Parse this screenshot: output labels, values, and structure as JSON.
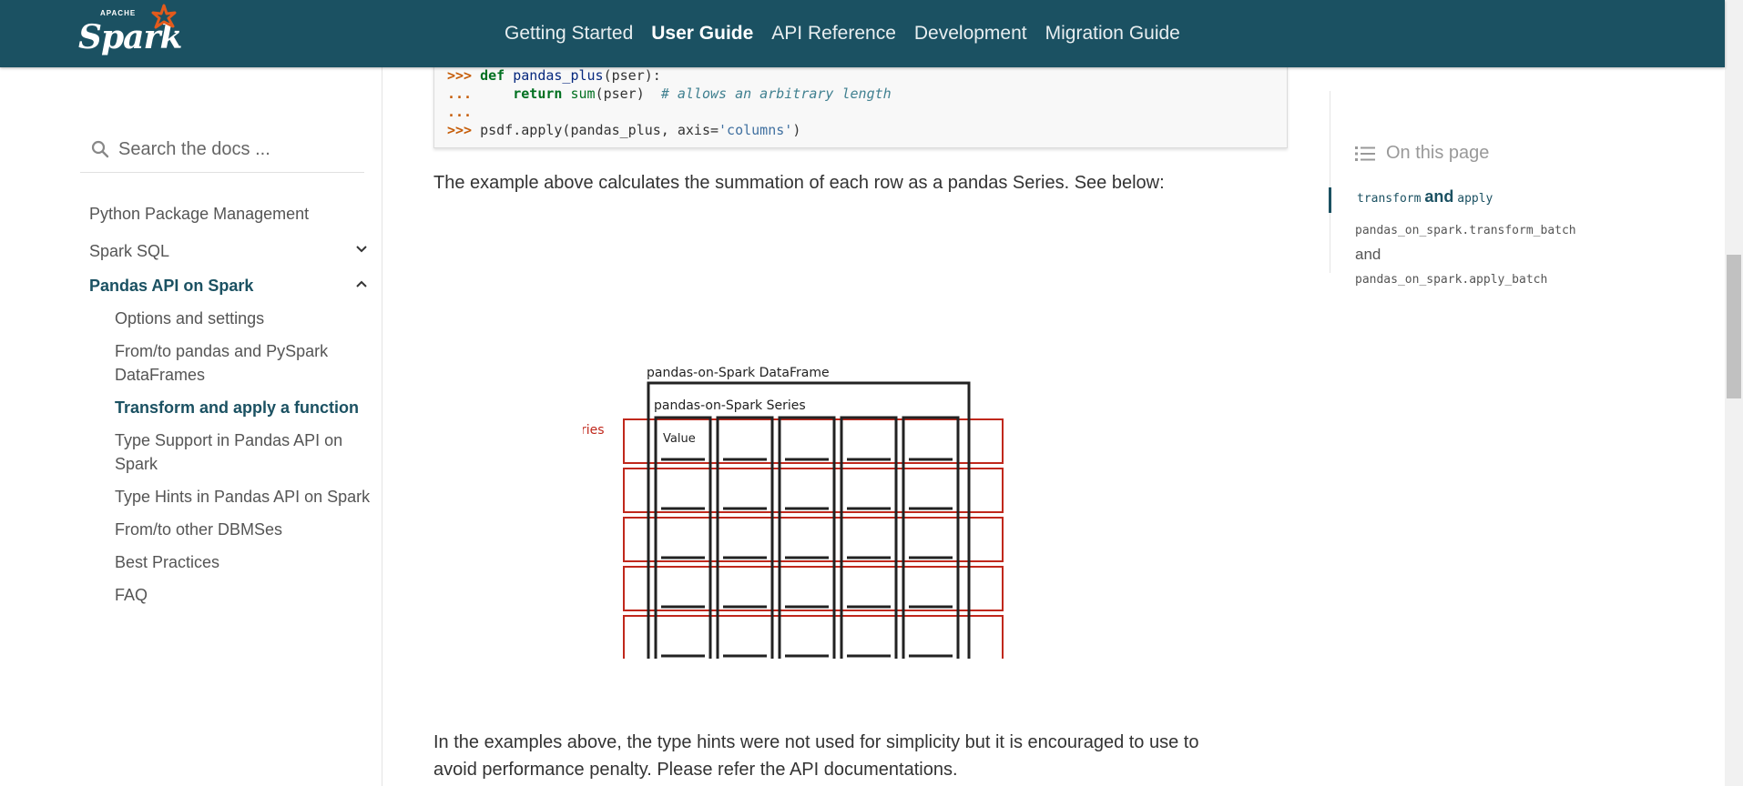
{
  "brand": {
    "apache": "APACHE",
    "spark": "Spark"
  },
  "nav": {
    "items": [
      "Getting Started",
      "User Guide",
      "API Reference",
      "Development",
      "Migration Guide"
    ],
    "active": "User Guide"
  },
  "sidebar": {
    "search_placeholder": "Search the docs ...",
    "items": [
      {
        "label": "Python Package Management"
      },
      {
        "label": "Spark SQL"
      },
      {
        "label": "Pandas API on Spark"
      },
      {
        "label": "Options and settings"
      },
      {
        "label": "From/to pandas and PySpark DataFrames"
      },
      {
        "label": "Transform and apply a function"
      },
      {
        "label": "Type Support in Pandas API on Spark"
      },
      {
        "label": "Type Hints in Pandas API on Spark"
      },
      {
        "label": "From/to other DBMSes"
      },
      {
        "label": "Best Practices"
      },
      {
        "label": "FAQ"
      }
    ]
  },
  "code": {
    "prompt1": ">>>",
    "kw_def": "def",
    "fn_name": "pandas_plus",
    "args": "(pser):",
    "prompt2": "...",
    "kw_return": "return",
    "bi_sum": "sum",
    "sum_args": "(pser)",
    "comment": "# allows an arbitrary length",
    "prompt3": "...",
    "prompt4": ">>>",
    "apply_call": "psdf.apply(pandas_plus, axis=",
    "apply_str": "'columns'",
    "apply_end": ")"
  },
  "main": {
    "para1": "The example above calculates the summation of each row as a pandas Series. See below:",
    "para2_line1": "In the examples above, the type hints were not used for simplicity but it is encouraged to use to",
    "para2_line2": "avoid performance penalty. Please refer the API documentations."
  },
  "figure": {
    "df_label": "pandas-on-Spark DataFrame",
    "series_label": "pandas-on-Spark Series",
    "pandas_series_label": "Pandas Series",
    "value_label": "Value",
    "rows": 6,
    "cols": 5
  },
  "toc": {
    "header": "On this page",
    "entry1_a": "transform",
    "entry1_and": "and",
    "entry1_b": "apply",
    "entry2_a": "pandas_on_spark.transform_batch",
    "entry2_and": "and",
    "entry2_b": "pandas_on_spark.apply_batch"
  },
  "colors": {
    "nav_bg": "#1b5162",
    "accent": "#1b5162",
    "series_red": "#c0281c"
  }
}
